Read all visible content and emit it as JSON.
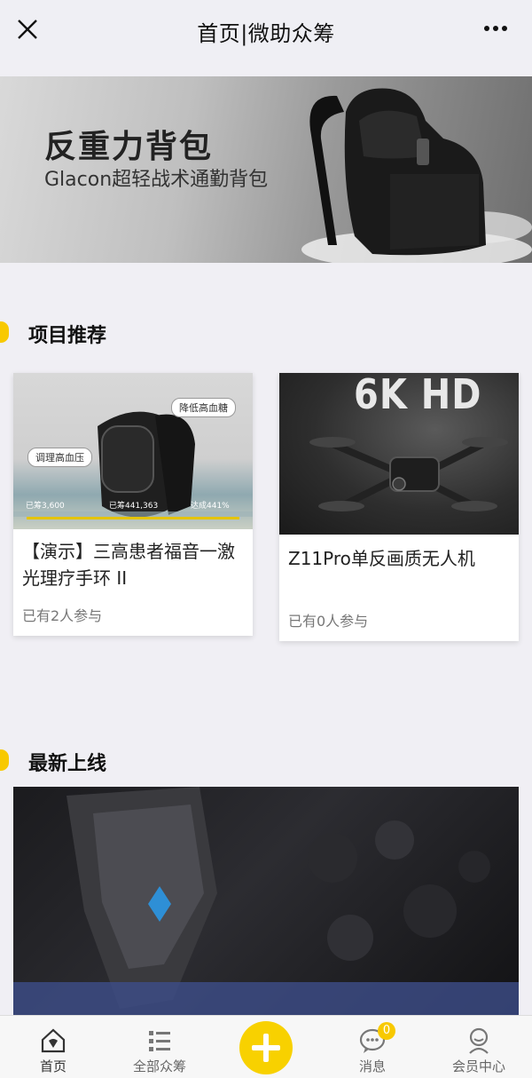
{
  "header": {
    "title": "首页|微助众筹"
  },
  "banner": {
    "title": "反重力背包",
    "subtitle": "Glacon超轻战术通勤背包",
    "active_index": 0,
    "slide_count": 3
  },
  "recommend": {
    "heading": "项目推荐",
    "items": [
      {
        "name": "【演示】三高患者福音一激光理疗手环 II",
        "joined": "已有2人参与",
        "image_tags": [
          "降低高血糖",
          "调理高血压"
        ],
        "image_stats": [
          "已筹3,600",
          "已筹441,363",
          "达成441%"
        ]
      },
      {
        "name": "Z11Pro单反画质无人机",
        "joined": "已有0人参与",
        "image_text": "6K HD"
      }
    ]
  },
  "latest": {
    "heading": "最新上线"
  },
  "tabbar": {
    "items": [
      {
        "label": "首页",
        "icon": "home-icon"
      },
      {
        "label": "全部众筹",
        "icon": "list-icon"
      },
      {
        "label": "",
        "icon": "plus-icon"
      },
      {
        "label": "消息",
        "icon": "message-icon"
      },
      {
        "label": "会员中心",
        "icon": "member-icon"
      }
    ],
    "message_badge": "0"
  },
  "colors": {
    "accent": "#f8c900",
    "background": "#f0eff4"
  }
}
